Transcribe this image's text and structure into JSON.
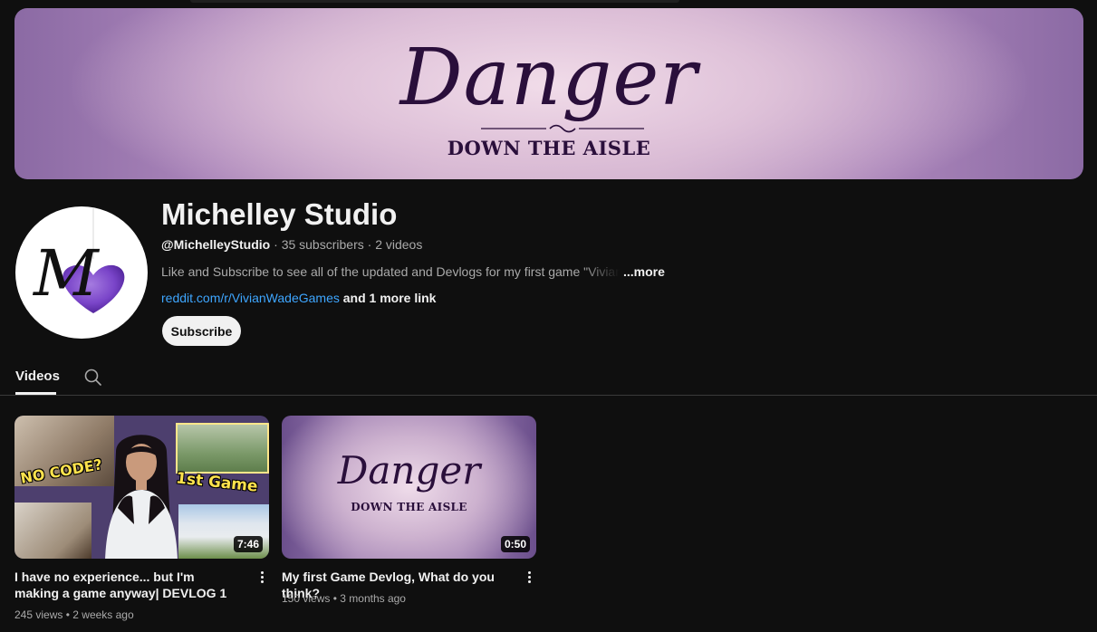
{
  "banner": {
    "title": "Danger",
    "subtitle": "DOWN THE AISLE"
  },
  "channel": {
    "name": "Michelley Studio",
    "handle": "@MichelleyStudio",
    "subscribers": "35 subscribers",
    "video_count": "2 videos",
    "separator": "·",
    "description": "Like and Subscribe to see all of the updated and Devlogs for my first game \"Vivian Wade: Danger Down the Aisle\"",
    "more_label": "...more",
    "link_text": "reddit.com/r/VivianWadeGames",
    "more_links": "and 1 more link",
    "subscribe_label": "Subscribe",
    "avatar_letter": "M"
  },
  "tabs": {
    "videos_label": "Videos"
  },
  "videos": [
    {
      "title": "I have no experience... but I'm making a game anyway| DEVLOG 1",
      "views": "245 views",
      "age": "2 weeks ago",
      "duration": "7:46",
      "thumb_text_1": "NO CODE?",
      "thumb_text_2": "1st Game"
    },
    {
      "title": "My first Game Devlog, What do you think?",
      "views": "150 views",
      "age": "3 months ago",
      "duration": "0:50",
      "thumb_title": "Danger",
      "thumb_subtitle": "DOWN THE AISLE"
    }
  ],
  "colors": {
    "background": "#0f0f0f",
    "link": "#3ea6ff",
    "text_primary": "#f1f1f1",
    "text_secondary": "#aaaaaa",
    "brand_purple": "#2a0f3b"
  }
}
